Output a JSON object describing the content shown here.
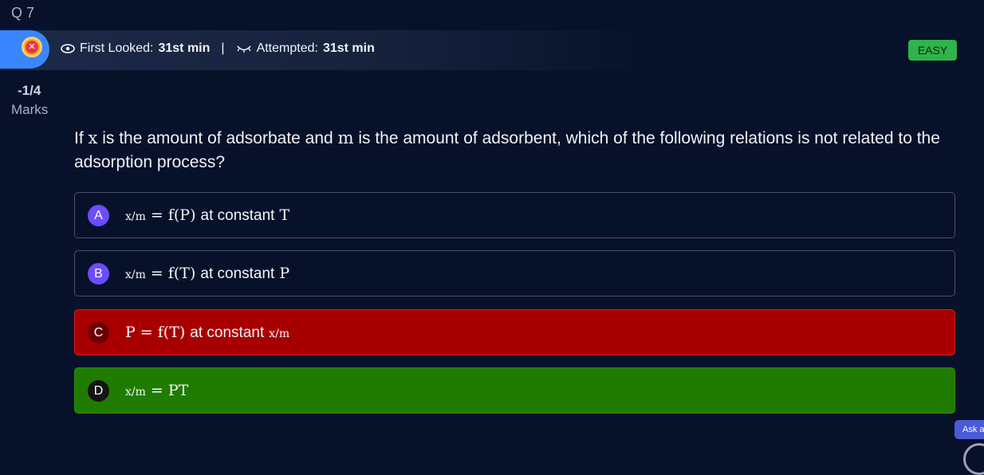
{
  "question_number": "Q 7",
  "status": {
    "first_looked_label": "First Looked:",
    "first_looked_value": "31st min",
    "separator": "|",
    "attempted_label": "Attempted:",
    "attempted_value": "31st min",
    "difficulty": "EASY"
  },
  "marks": {
    "score": "-1/4",
    "label": "Marks"
  },
  "question": {
    "t1": "If ",
    "v1": "x",
    "t2": " is the amount of adsorbate and ",
    "v2": "m",
    "t3": " is the amount of adsorbent, which of the following relations is not related to the adsorption process?"
  },
  "options": [
    {
      "letter": "A",
      "lhs": "x/m",
      "eq": "= f(P)",
      "text": "at constant",
      "var": "T",
      "state": "neutral"
    },
    {
      "letter": "B",
      "lhs": "x/m",
      "eq": "= f(T)",
      "text": "at constant",
      "var": "P",
      "state": "neutral"
    },
    {
      "letter": "C",
      "lhs": "P",
      "eq": "= f(T)",
      "text": "at constant",
      "var": "x/m",
      "state": "wrong"
    },
    {
      "letter": "D",
      "lhs": "x/m",
      "eq": "= PT",
      "text": "",
      "var": "",
      "state": "correct"
    }
  ],
  "ask_button": "Ask a",
  "colors": {
    "wrong": "#a80000",
    "correct": "#207c00",
    "easy": "#2fb34a",
    "accent": "#3a86ff"
  }
}
